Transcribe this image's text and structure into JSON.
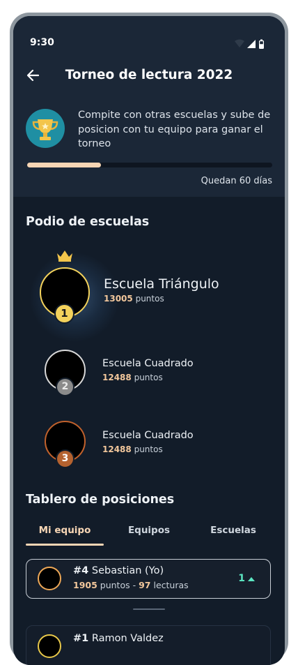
{
  "status": {
    "time": "9:30",
    "icons": [
      "wifi-icon",
      "signal-icon",
      "battery-icon"
    ]
  },
  "header": {
    "title": "Torneo de lectura 2022",
    "back_icon": "arrow-left-icon"
  },
  "intro": {
    "text": "Compite con otras escuelas y sube de posicion con tu equipo para ganar el torneo",
    "icon": "trophy-icon",
    "progress": 0.3,
    "remaining": "Quedan 60 días"
  },
  "podium": {
    "title": "Podio de escuelas",
    "schools": [
      {
        "rank": "1",
        "name": "Escuela Triángulo",
        "points": "13005",
        "points_label": "puntos"
      },
      {
        "rank": "2",
        "name": "Escuela Cuadrado",
        "points": "12488",
        "points_label": "puntos"
      },
      {
        "rank": "3",
        "name": "Escuela Cuadrado",
        "points": "12488",
        "points_label": "puntos"
      }
    ]
  },
  "leaderboard": {
    "title": "Tablero de posiciones",
    "tabs": [
      {
        "label": "Mi equipo",
        "active": true
      },
      {
        "label": "Equipos",
        "active": false
      },
      {
        "label": "Escuelas",
        "active": false
      }
    ],
    "mine": {
      "rank": "#4",
      "name": "Sebastian (Yo)",
      "points": "1905",
      "points_label": "puntos",
      "sep": "-",
      "reads": "97",
      "reads_label": "lecturas",
      "change": "1"
    },
    "next": {
      "rank": "#1",
      "name": "Ramon Valdez"
    }
  },
  "colors": {
    "background": "#121c29",
    "header_bg": "#1b2737",
    "accent": "#f7d6b5",
    "gold": "#f3d25c",
    "silver": "#8b8b8b",
    "bronze": "#b4622f",
    "up": "#5ce6c2"
  }
}
